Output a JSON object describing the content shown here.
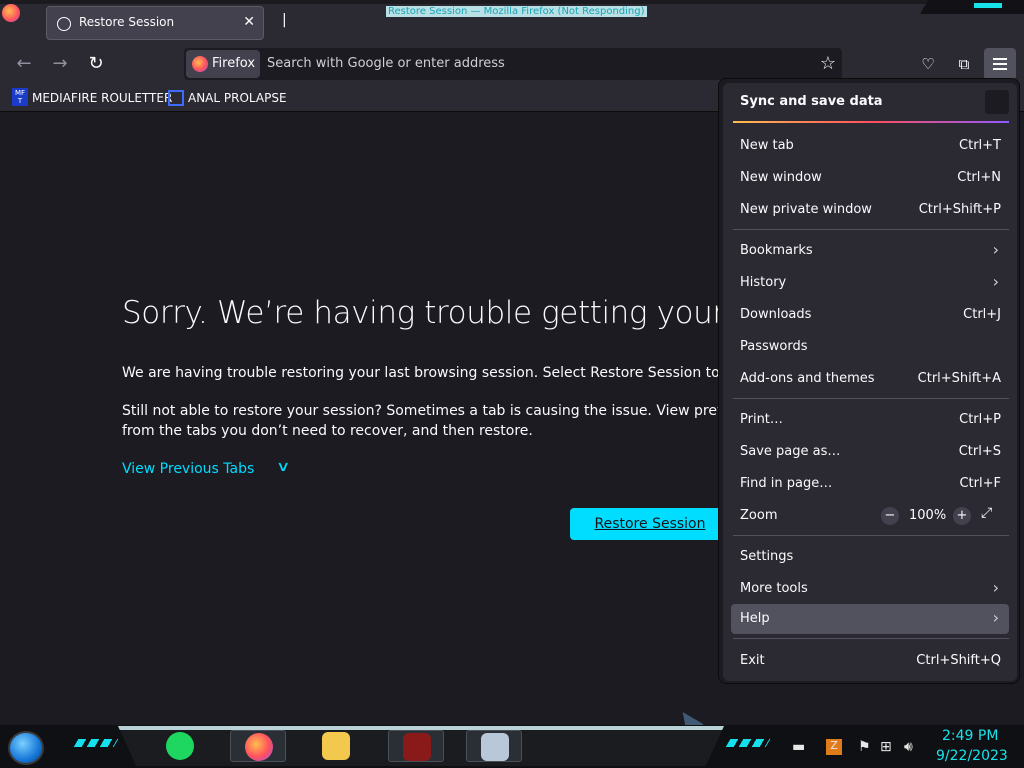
{
  "window": {
    "title": "Restore Session — Mozilla Firefox (Not Responding)"
  },
  "tabs": [
    {
      "label": "Restore Session"
    }
  ],
  "navbar": {
    "chip_label": "Firefox",
    "placeholder": "Search with Google or enter address"
  },
  "bookmarks": [
    {
      "label": "MEDIAFIRE ROULETTER",
      "icon_text": "MF T"
    },
    {
      "label": "ANAL PROLAPSE"
    }
  ],
  "page": {
    "heading": "Sorry. We’re having trouble getting your pa",
    "paragraph1": "We are having trouble restoring your last browsing session. Select Restore Session to try ag",
    "paragraph2": "Still not able to restore your session? Sometimes a tab is causing the issue. View previous t",
    "paragraph2b": "from the tabs you don’t need to recover, and then restore.",
    "view_previous": "View Previous Tabs",
    "restore_button": "Restore Session",
    "restore_button_underlined_letter": "R"
  },
  "app_menu": {
    "sync_label": "Sync and save data",
    "items": [
      {
        "label": "New tab",
        "shortcut": "Ctrl+T"
      },
      {
        "label": "New window",
        "shortcut": "Ctrl+N"
      },
      {
        "label": "New private window",
        "shortcut": "Ctrl+Shift+P"
      },
      {
        "label": "Bookmarks",
        "shortcut": ""
      },
      {
        "label": "History",
        "shortcut": ""
      },
      {
        "label": "Downloads",
        "shortcut": "Ctrl+J"
      },
      {
        "label": "Passwords",
        "shortcut": ""
      },
      {
        "label": "Add-ons and themes",
        "shortcut": "Ctrl+Shift+A"
      },
      {
        "label": "Print…",
        "shortcut": "Ctrl+P"
      },
      {
        "label": "Save page as…",
        "shortcut": "Ctrl+S"
      },
      {
        "label": "Find in page…",
        "shortcut": "Ctrl+F"
      },
      {
        "label": "Zoom",
        "shortcut": ""
      },
      {
        "label": "Settings",
        "shortcut": ""
      },
      {
        "label": "More tools",
        "shortcut": ""
      },
      {
        "label": "Help",
        "shortcut": ""
      },
      {
        "label": "Exit",
        "shortcut": "Ctrl+Shift+Q"
      }
    ],
    "zoom": {
      "minus": "−",
      "value": "100%",
      "plus": "+"
    }
  },
  "taskbar": {
    "time": "2:49 PM",
    "date": "9/22/2023"
  },
  "colors": {
    "accent": "#00ddff",
    "toolbar": "#2b2a33",
    "background": "#1c1b22",
    "clock": "#19e3ea"
  },
  "icons": [
    "firefox-icon",
    "back-arrow-icon",
    "forward-arrow-icon",
    "reload-icon",
    "star-icon",
    "pocket-icon",
    "extensions-icon",
    "hamburger-menu-icon",
    "chevron-down-icon",
    "chevron-right-icon",
    "fullscreen-icon",
    "start-orb-icon",
    "spotify-icon",
    "file-explorer-icon",
    "volume-icon",
    "network-icon",
    "flag-icon"
  ]
}
